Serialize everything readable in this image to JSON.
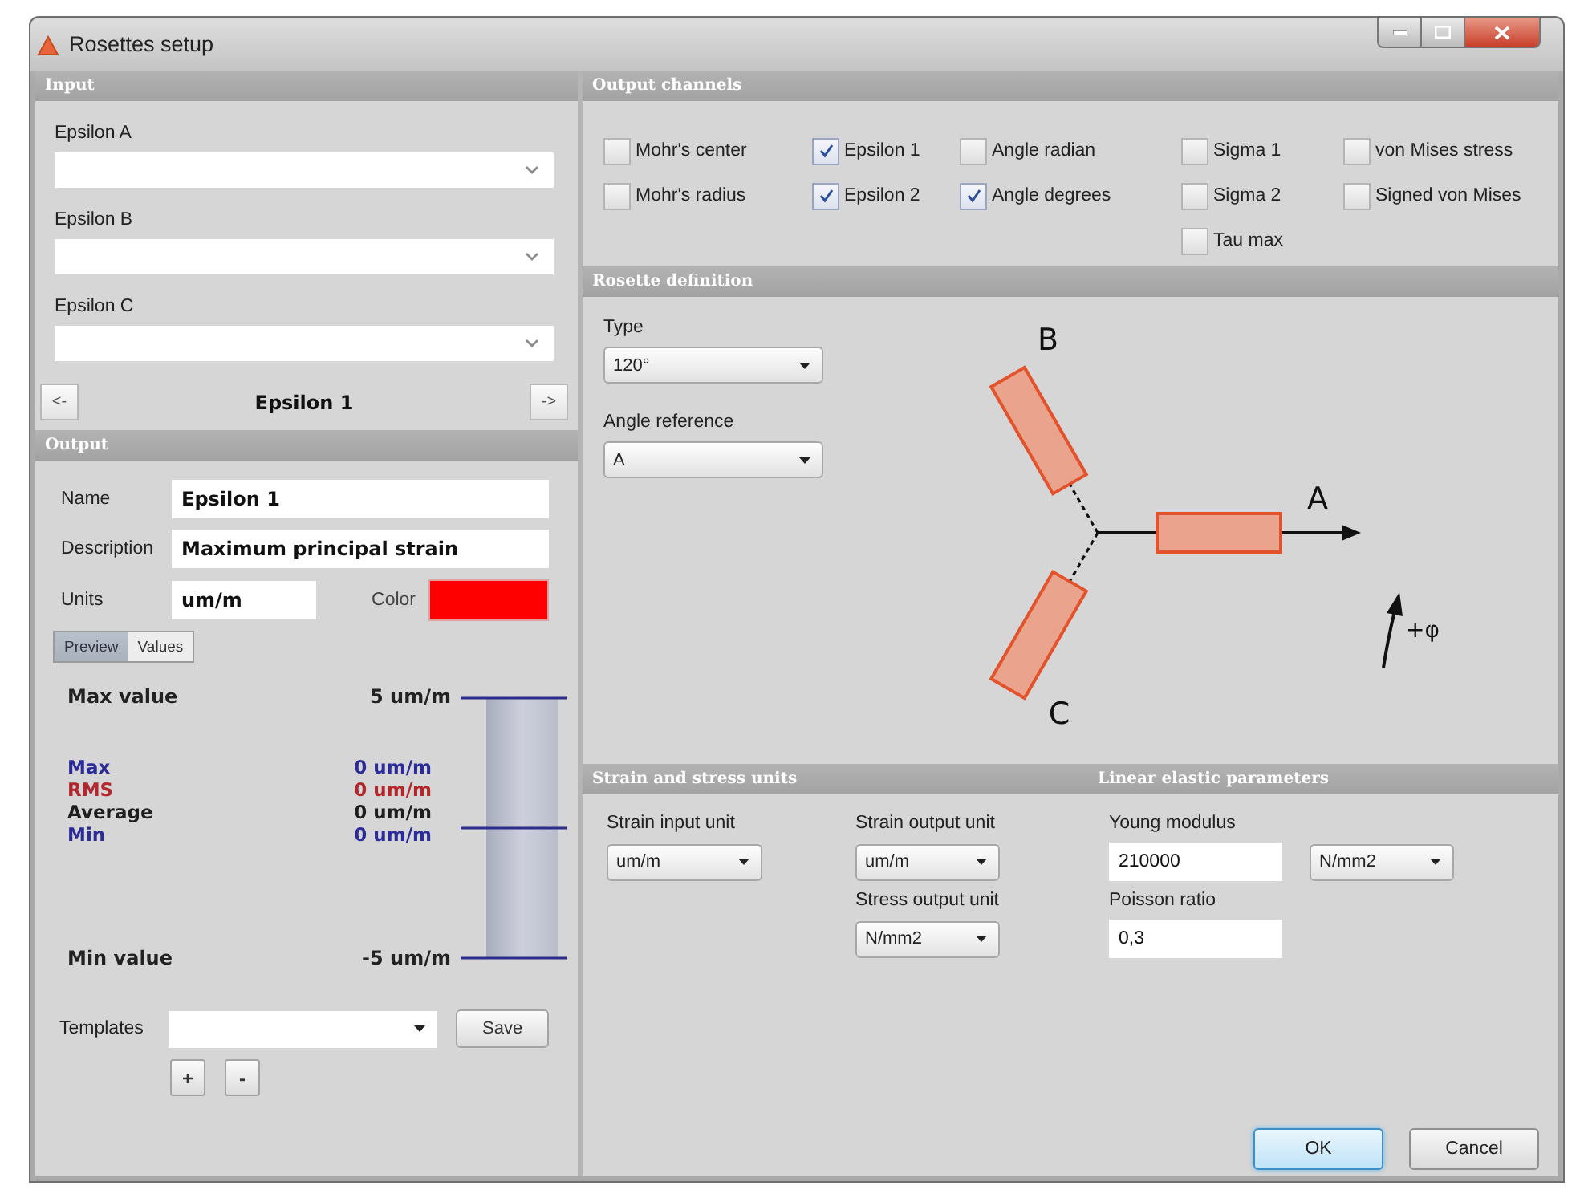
{
  "window": {
    "title": "Rosettes setup"
  },
  "input": {
    "header": "Input",
    "fields": [
      {
        "label": "Epsilon A"
      },
      {
        "label": "Epsilon B"
      },
      {
        "label": "Epsilon C"
      }
    ]
  },
  "navigator": {
    "previous": "<-",
    "current": "Epsilon 1",
    "next": "->"
  },
  "output": {
    "header": "Output",
    "name": {
      "label": "Name",
      "value": "Epsilon 1"
    },
    "description": {
      "label": "Description",
      "value": "Maximum principal strain"
    },
    "units": {
      "label": "Units",
      "value": "um/m"
    },
    "color": {
      "label": "Color",
      "color": "#ff0000"
    }
  },
  "view_tabs": [
    {
      "label": "Preview",
      "selected": true
    },
    {
      "label": "Values",
      "selected": false
    }
  ],
  "preview": {
    "max": {
      "label": "Max value",
      "value": "5 um/m"
    },
    "stats": [
      {
        "label": "Max",
        "value": "0 um/m",
        "color": "#2b2b99"
      },
      {
        "label": "RMS",
        "value": "0 um/m",
        "color": "#b3262b"
      },
      {
        "label": "Average",
        "value": "0 um/m",
        "color": "#1e1e1e"
      },
      {
        "label": "Min",
        "value": "0 um/m",
        "color": "#2b2b99"
      }
    ],
    "min": {
      "label": "Min value",
      "value": "-5 um/m"
    }
  },
  "templates": {
    "label": "Templates",
    "save": "Save",
    "add": "+",
    "remove": "-"
  },
  "output_channels": {
    "header": "Output channels",
    "columns": [
      [
        {
          "label": "Mohr's center",
          "checked": false
        },
        {
          "label": "Mohr's radius",
          "checked": false
        }
      ],
      [
        {
          "label": "Epsilon 1",
          "checked": true
        },
        {
          "label": "Epsilon 2",
          "checked": true
        }
      ],
      [
        {
          "label": "Angle radian",
          "checked": false
        },
        {
          "label": "Angle degrees",
          "checked": true
        }
      ],
      [
        {
          "label": "Sigma 1",
          "checked": false
        },
        {
          "label": "Sigma 2",
          "checked": false
        },
        {
          "label": "Tau max",
          "checked": false
        }
      ],
      [
        {
          "label": "von Mises stress",
          "checked": false
        },
        {
          "label": "Signed von Mises",
          "checked": false
        }
      ]
    ]
  },
  "rosette": {
    "header": "Rosette definition",
    "type": {
      "label": "Type",
      "value": "120°"
    },
    "angle_reference": {
      "label": "Angle reference",
      "value": "A"
    },
    "diagram": {
      "gauges": [
        "A",
        "B",
        "C"
      ],
      "rotation": "+φ"
    }
  },
  "units": {
    "header": "Strain and stress units",
    "strain_input": {
      "label": "Strain input unit",
      "value": "um/m"
    },
    "strain_output": {
      "label": "Strain output unit",
      "value": "um/m"
    },
    "stress_output": {
      "label": "Stress output unit",
      "value": "N/mm2"
    }
  },
  "elastic": {
    "header": "Linear elastic parameters",
    "young_modulus": {
      "label": "Young modulus",
      "value": "210000",
      "unit": "N/mm2"
    },
    "poisson_ratio": {
      "label": "Poisson ratio",
      "value": "0,3"
    }
  },
  "buttons": [
    {
      "label": "OK",
      "kind": "default"
    },
    {
      "label": "Cancel",
      "kind": "normal"
    }
  ]
}
